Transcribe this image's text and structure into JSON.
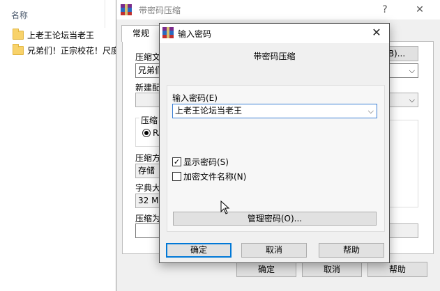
{
  "explorer": {
    "column_header": "名称",
    "files": [
      {
        "name": "上老王论坛当老王",
        "icon": "folder-icon"
      },
      {
        "name": "兄弟们！正宗校花！尺度",
        "icon": "folder-icon"
      }
    ]
  },
  "main_window": {
    "title": "带密码压缩",
    "help_button": "?",
    "close_button": "✕",
    "tab_general": "常规",
    "archive_name_label": "压缩文",
    "archive_name_value": "兄弟们",
    "browse_button": "B)...",
    "new_profile_label": "新建配",
    "format_group_label": "压缩",
    "format_option": "RA",
    "method_label": "压缩方",
    "method_value": "存储",
    "dict_label": "字典大",
    "dict_value": "32 MB",
    "split_label": "压缩为",
    "ok_button": "确定",
    "cancel_button": "取消",
    "help_button_label": "帮助"
  },
  "dialog": {
    "title": "输入密码",
    "close": "✕",
    "heading": "带密码压缩",
    "password_label": "输入密码(E)",
    "password_value": "上老王论坛当老王",
    "show_password_label": "显示密码(S)",
    "show_password_checked": "✓",
    "encrypt_names_label": "加密文件名称(N)",
    "manage_button": "管理密码(O)...",
    "ok_button": "确定",
    "cancel_button": "取消",
    "help_button": "帮助"
  }
}
